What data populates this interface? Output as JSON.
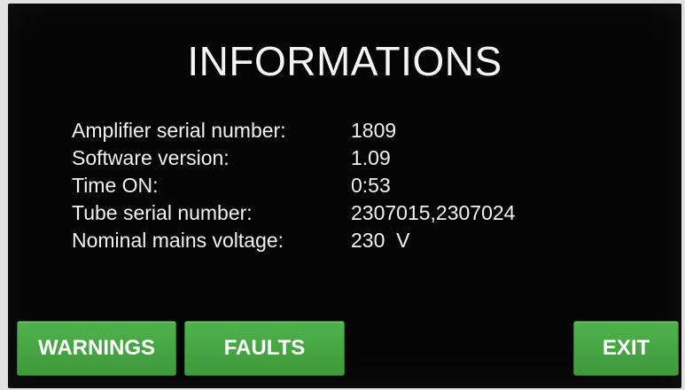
{
  "screen": {
    "title": "INFORMATIONS"
  },
  "info": {
    "rows": [
      {
        "label": "Amplifier serial number:",
        "value": "1809"
      },
      {
        "label": "Software version:",
        "value": "1.09"
      },
      {
        "label": "Time ON:",
        "value": "0:53"
      },
      {
        "label": "Tube serial number:",
        "value": "2307015,2307024"
      },
      {
        "label": "Nominal mains voltage:",
        "value": "230  V"
      }
    ]
  },
  "buttons": {
    "warnings": "WARNINGS",
    "faults": "FAULTS",
    "exit": "EXIT"
  },
  "colors": {
    "background": "#050505",
    "text": "#f2f2f2",
    "button_green": "#45a542"
  }
}
